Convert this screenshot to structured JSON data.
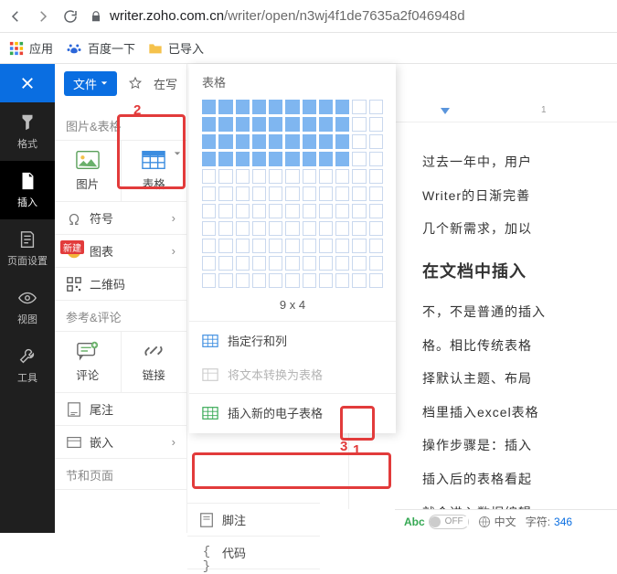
{
  "browser": {
    "url_host": "writer.zoho.com.cn",
    "url_path": "/writer/open/n3wj4f1de7635a2f046948d"
  },
  "bookmarks": {
    "apps": "应用",
    "baidu": "百度一下",
    "imported": "已导入"
  },
  "toolbar": {
    "file_label": "文件",
    "writing_mode": "在写"
  },
  "rail": {
    "format": "格式",
    "insert": "插入",
    "page_setup": "页面设置",
    "view": "视图",
    "tools": "工具"
  },
  "panel": {
    "section_pic_table": "图片&表格",
    "image": "图片",
    "table": "表格",
    "symbol": "符号",
    "chart": "图表",
    "chart_new_badge": "新建",
    "qrcode": "二维码",
    "section_review": "参考&评论",
    "comment": "评论",
    "link": "链接",
    "endnote": "尾注",
    "footnote": "脚注",
    "embed": "嵌入",
    "code": "代码",
    "section_page": "节和页面"
  },
  "popup": {
    "title": "表格",
    "grid_cols": 11,
    "grid_rows": 11,
    "sel_cols": 9,
    "sel_rows": 4,
    "readout": "9 x 4",
    "specify": "指定行和列",
    "convert": "将文本转换为表格",
    "insert_sheet": "插入新的电子表格"
  },
  "doc": {
    "p1": "过去一年中，用户",
    "p1b": "Writer的日渐完善",
    "p1c": "几个新需求，加以",
    "h1": "在文档中插入",
    "p2": "不，不是普通的插入",
    "p2b": "格。相比传统表格",
    "p2c": "择默认主题、布局",
    "p2d": "档里插入excel表格",
    "p2e": "操作步骤是：插入",
    "p2f": "插入后的表格看起",
    "p2g": "就会进入数据编辑"
  },
  "annotations": {
    "n1": "1",
    "n2": "2",
    "n3": "3"
  },
  "status": {
    "spell_label": "Abc",
    "spell_off": "OFF",
    "lang": "中文",
    "chars_label": "字符:",
    "chars": "346"
  }
}
